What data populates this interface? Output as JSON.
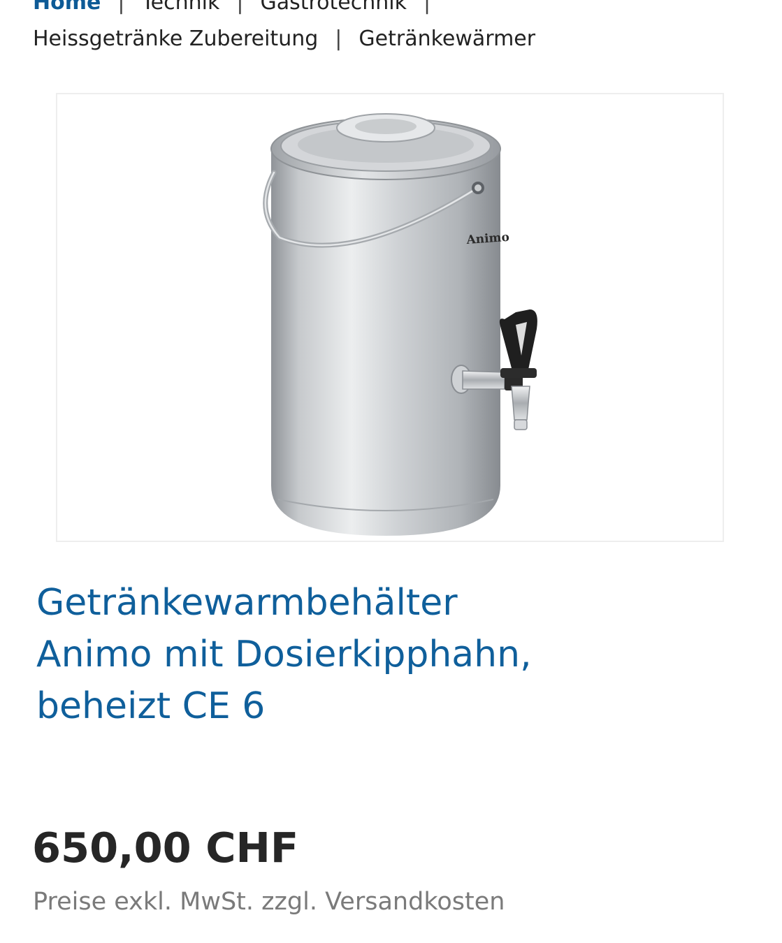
{
  "breadcrumb": {
    "row1": [
      "Home",
      "Technik",
      "Gastrotechnik"
    ],
    "row2": [
      "Heissgetränke Zubereitung",
      "Getränkewärmer"
    ],
    "separator": "|"
  },
  "product": {
    "image_brand": "Animo",
    "title": "Getränkewarmbehälter Animo mit Dosierkipphahn, beheizt CE 6",
    "price": "650,00 CHF",
    "tax_note": "Preise exkl. MwSt. zzgl. Versandkosten"
  }
}
